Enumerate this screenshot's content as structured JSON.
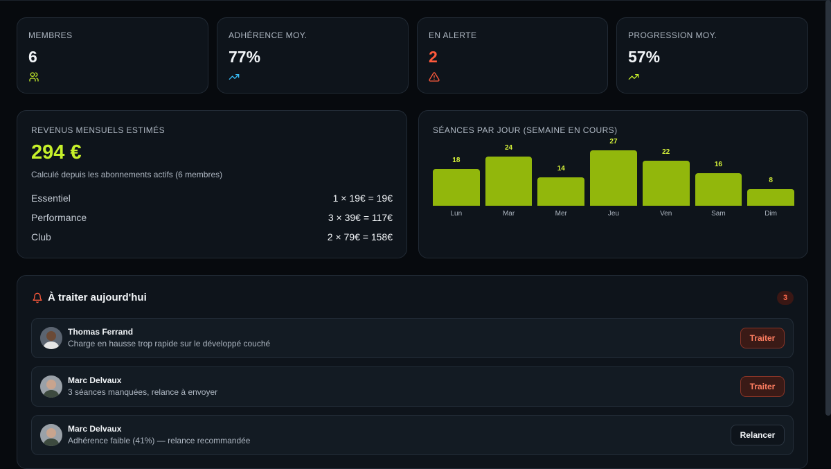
{
  "stats": [
    {
      "label": "MEMBRES",
      "value": "6",
      "icon": "users-icon",
      "color": "#f2f5f8",
      "icon_color": "#c6f02a"
    },
    {
      "label": "ADHÉRENCE MOY.",
      "value": "77%",
      "icon": "trending-up-icon",
      "color": "#f2f5f8",
      "icon_color": "#38bdf8"
    },
    {
      "label": "EN ALERTE",
      "value": "2",
      "icon": "warning-icon",
      "color": "#ff5a3c",
      "icon_color": "#ff5a3c"
    },
    {
      "label": "PROGRESSION MOY.",
      "value": "57%",
      "icon": "trending-up-icon",
      "color": "#f2f5f8",
      "icon_color": "#c6f02a"
    }
  ],
  "revenue": {
    "label": "REVENUS MENSUELS ESTIMÉS",
    "value": "294 €",
    "subtitle": "Calculé depuis les abonnements actifs (6 membres)",
    "plans": [
      {
        "name": "Essentiel",
        "calc": "1 × 19€ = 19€"
      },
      {
        "name": "Performance",
        "calc": "3 × 39€ = 117€"
      },
      {
        "name": "Club",
        "calc": "2 × 79€ = 158€"
      }
    ]
  },
  "sessions": {
    "label": "SÉANCES PAR JOUR (SEMAINE EN COURS)"
  },
  "chart_data": {
    "type": "bar",
    "categories": [
      "Lun",
      "Mar",
      "Mer",
      "Jeu",
      "Ven",
      "Sam",
      "Dim"
    ],
    "values": [
      18,
      24,
      14,
      27,
      22,
      16,
      8
    ],
    "title": "SÉANCES PAR JOUR (SEMAINE EN COURS)",
    "xlabel": "",
    "ylabel": "",
    "ylim": [
      0,
      27
    ],
    "grid": false,
    "bar_color": "#92b70c",
    "label_color": "#d8f53a"
  },
  "tasks": {
    "title": "À traiter aujourd'hui",
    "count": "3",
    "icon": "bell-icon",
    "items": [
      {
        "name": "Thomas Ferrand",
        "desc": "Charge en hausse trop rapide sur le développé couché",
        "action": "Traiter",
        "action_type": "traiter"
      },
      {
        "name": "Marc Delvaux",
        "desc": "3 séances manquées, relance à envoyer",
        "action": "Traiter",
        "action_type": "traiter"
      },
      {
        "name": "Marc Delvaux",
        "desc": "Adhérence faible (41%) — relance recommandée",
        "action": "Relancer",
        "action_type": "relancer"
      }
    ]
  }
}
